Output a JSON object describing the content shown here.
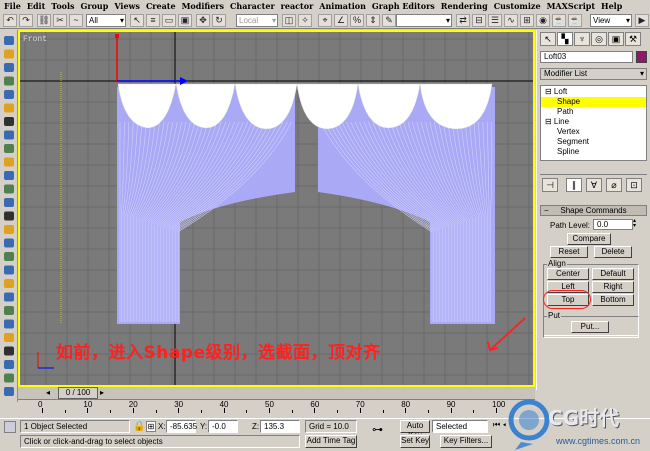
{
  "menu": [
    "File",
    "Edit",
    "Tools",
    "Group",
    "Views",
    "Create",
    "Modifiers",
    "Character",
    "reactor",
    "Animation",
    "Graph Editors",
    "Rendering",
    "Customize",
    "MAXScript",
    "Help"
  ],
  "toolbar": {
    "filter_value": "All",
    "coord_value": "View",
    "grid_value": "Local",
    "selection_set": ""
  },
  "viewport": {
    "label": "Front",
    "annotation": "如前，进入Shape级别，选截面，顶对齐"
  },
  "panel": {
    "object_name": "Loft03",
    "object_color": "#8b1a6b",
    "modifier_list_label": "Modifier List",
    "stack": [
      {
        "label": "Loft",
        "selected": false,
        "indent": 0,
        "expander": "⊟"
      },
      {
        "label": "Shape",
        "selected": true,
        "indent": 1,
        "expander": ""
      },
      {
        "label": "Path",
        "selected": false,
        "indent": 1,
        "expander": ""
      },
      {
        "label": "Line",
        "selected": false,
        "indent": 0,
        "expander": "⊟"
      },
      {
        "label": "Vertex",
        "selected": false,
        "indent": 1,
        "expander": ""
      },
      {
        "label": "Segment",
        "selected": false,
        "indent": 1,
        "expander": ""
      },
      {
        "label": "Spline",
        "selected": false,
        "indent": 1,
        "expander": ""
      }
    ],
    "rollout_title": "Shape Commands",
    "path_level_label": "Path Level:",
    "path_level_value": "0.0",
    "compare_label": "Compare",
    "reset_label": "Reset",
    "delete_label": "Delete",
    "align_label": "Align",
    "center_label": "Center",
    "default_label": "Default",
    "left_label": "Left",
    "right_label": "Right",
    "top_label": "Top",
    "bottom_label": "Bottom",
    "put_group_label": "Put",
    "put_label": "Put..."
  },
  "time": {
    "scrubber": "0 / 100",
    "ticks": [
      "0",
      "10",
      "20",
      "30",
      "40",
      "50",
      "60",
      "70",
      "80",
      "90",
      "100"
    ]
  },
  "status": {
    "selected": "1 Object Selected",
    "prompt": "Click or click-and-drag to select objects",
    "x_label": "X:",
    "x_value": "-85.635",
    "y_label": "Y:",
    "y_value": "-0.0",
    "z_label": "Z:",
    "z_value": "135.3",
    "grid": "Grid = 10.0",
    "add_time_tag": "Add Time Tag",
    "auto_key": "Auto Key",
    "set_key": "Set Key",
    "key_mode": "Selected",
    "key_filters": "Key Filters..."
  },
  "logo": {
    "brand": "CG时代",
    "url": "www.cgtimes.com.cn"
  },
  "colors": {
    "accent_yellow": "#ffff00",
    "curtain": "#aaaaff",
    "annotation": "#ff2020",
    "logo_blue": "#2a7ad0"
  }
}
